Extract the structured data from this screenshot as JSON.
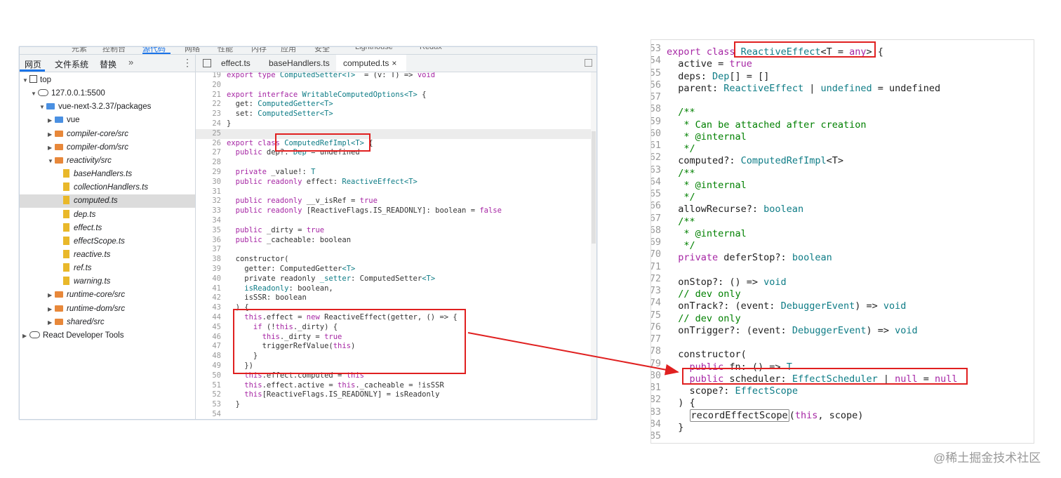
{
  "devtools": {
    "top_tabs_cut": [
      "元素",
      "控制台",
      "源代码",
      "网络",
      "性能",
      "内存",
      "应用",
      "安全",
      "Lighthouse",
      "Redux"
    ],
    "nav_tabs": [
      "网页",
      "文件系统",
      "替换"
    ],
    "nav_more": "»",
    "nav_kebab": "⋮",
    "tree": [
      {
        "label": "top",
        "depth": 0,
        "icon": "frame",
        "tri": "▼"
      },
      {
        "label": "127.0.0.1:5500",
        "depth": 1,
        "icon": "cloud",
        "tri": "▼"
      },
      {
        "label": "vue-next-3.2.37/packages",
        "depth": 2,
        "icon": "folder-blue",
        "tri": "▼"
      },
      {
        "label": "vue",
        "depth": 3,
        "icon": "folder-blue",
        "tri": "▶"
      },
      {
        "label": "compiler-core/src",
        "depth": 3,
        "icon": "folder-orange",
        "tri": "▶",
        "italic": true
      },
      {
        "label": "compiler-dom/src",
        "depth": 3,
        "icon": "folder-orange",
        "tri": "▶",
        "italic": true
      },
      {
        "label": "reactivity/src",
        "depth": 3,
        "icon": "folder-orange",
        "tri": "▼",
        "italic": true
      },
      {
        "label": "baseHandlers.ts",
        "depth": 4,
        "icon": "file",
        "tri": "",
        "italic": true
      },
      {
        "label": "collectionHandlers.ts",
        "depth": 4,
        "icon": "file",
        "tri": "",
        "italic": true
      },
      {
        "label": "computed.ts",
        "depth": 4,
        "icon": "file",
        "tri": "",
        "italic": true,
        "selected": true
      },
      {
        "label": "dep.ts",
        "depth": 4,
        "icon": "file",
        "tri": "",
        "italic": true
      },
      {
        "label": "effect.ts",
        "depth": 4,
        "icon": "file",
        "tri": "",
        "italic": true
      },
      {
        "label": "effectScope.ts",
        "depth": 4,
        "icon": "file",
        "tri": "",
        "italic": true
      },
      {
        "label": "reactive.ts",
        "depth": 4,
        "icon": "file",
        "tri": "",
        "italic": true
      },
      {
        "label": "ref.ts",
        "depth": 4,
        "icon": "file",
        "tri": "",
        "italic": true
      },
      {
        "label": "warning.ts",
        "depth": 4,
        "icon": "file",
        "tri": "",
        "italic": true
      },
      {
        "label": "runtime-core/src",
        "depth": 3,
        "icon": "folder-orange",
        "tri": "▶",
        "italic": true
      },
      {
        "label": "runtime-dom/src",
        "depth": 3,
        "icon": "folder-orange",
        "tri": "▶",
        "italic": true
      },
      {
        "label": "shared/src",
        "depth": 3,
        "icon": "folder-orange",
        "tri": "▶",
        "italic": true
      },
      {
        "label": "React Developer Tools",
        "depth": 0,
        "icon": "cloud",
        "tri": "▶"
      }
    ],
    "editor_tabs": [
      "effect.ts",
      "baseHandlers.ts",
      "computed.ts"
    ],
    "editor_close": "×",
    "code": [
      {
        "n": "19",
        "t": [
          [
            "kw",
            "export type "
          ],
          [
            "ty",
            "ComputedSetter<T>"
          ],
          [
            "",
            "  = (v: T) => "
          ],
          [
            "kw",
            "void"
          ]
        ]
      },
      {
        "n": "20",
        "t": []
      },
      {
        "n": "21",
        "t": [
          [
            "kw",
            "export interface "
          ],
          [
            "ty",
            "WritableComputedOptions<T>"
          ],
          [
            "",
            " {"
          ]
        ]
      },
      {
        "n": "22",
        "t": [
          [
            "",
            "  get: "
          ],
          [
            "ty",
            "ComputedGetter<T>"
          ]
        ]
      },
      {
        "n": "23",
        "t": [
          [
            "",
            "  set: "
          ],
          [
            "ty",
            "ComputedSetter<T>"
          ]
        ]
      },
      {
        "n": "24",
        "t": [
          [
            "",
            "}"
          ]
        ]
      },
      {
        "n": "25",
        "t": [],
        "hl": true
      },
      {
        "n": "26",
        "t": [
          [
            "kw",
            "export class "
          ],
          [
            "ty",
            "ComputedRefImpl<T>"
          ],
          [
            "",
            " {"
          ]
        ]
      },
      {
        "n": "27",
        "t": [
          [
            "kw",
            "  public "
          ],
          [
            "",
            "dep?: "
          ],
          [
            "ty",
            "Dep"
          ],
          [
            "",
            " = undefined"
          ]
        ]
      },
      {
        "n": "28",
        "t": []
      },
      {
        "n": "29",
        "t": [
          [
            "kw",
            "  private "
          ],
          [
            "",
            "_value!: "
          ],
          [
            "ty",
            "T"
          ]
        ]
      },
      {
        "n": "30",
        "t": [
          [
            "kw",
            "  public readonly "
          ],
          [
            "",
            "effect: "
          ],
          [
            "ty",
            "ReactiveEffect<T>"
          ]
        ]
      },
      {
        "n": "31",
        "t": []
      },
      {
        "n": "32",
        "t": [
          [
            "kw",
            "  public readonly "
          ],
          [
            "",
            "__v_isRef = "
          ],
          [
            "kw",
            "true"
          ]
        ]
      },
      {
        "n": "33",
        "t": [
          [
            "kw",
            "  public readonly "
          ],
          [
            "",
            "[ReactiveFlags.IS_READONLY]: boolean = "
          ],
          [
            "kw",
            "false"
          ]
        ]
      },
      {
        "n": "34",
        "t": []
      },
      {
        "n": "35",
        "t": [
          [
            "kw",
            "  public "
          ],
          [
            "",
            "_dirty = "
          ],
          [
            "kw",
            "true"
          ]
        ]
      },
      {
        "n": "36",
        "t": [
          [
            "kw",
            "  public "
          ],
          [
            "",
            "_cacheable: boolean"
          ]
        ]
      },
      {
        "n": "37",
        "t": []
      },
      {
        "n": "38",
        "t": [
          [
            "",
            "  constructor("
          ]
        ]
      },
      {
        "n": "39",
        "t": [
          [
            "",
            "    getter: ComputedGetter"
          ],
          [
            "ty",
            "<T>"
          ],
          [
            ","
          ]
        ]
      },
      {
        "n": "40",
        "t": [
          [
            "",
            "    private readonly "
          ],
          [
            "ty",
            "_setter"
          ],
          [
            "",
            ": ComputedSetter"
          ],
          [
            "ty",
            "<T>"
          ],
          [
            ","
          ]
        ]
      },
      {
        "n": "41",
        "t": [
          [
            "ty",
            "    isReadonly"
          ],
          [
            "",
            ": boolean,"
          ]
        ]
      },
      {
        "n": "42",
        "t": [
          [
            "",
            "    isSSR: boolean"
          ]
        ]
      },
      {
        "n": "43",
        "t": [
          [
            "",
            "  ) {"
          ]
        ]
      },
      {
        "n": "44",
        "t": [
          [
            "kw",
            "    this"
          ],
          [
            "",
            ".effect = "
          ],
          [
            "kw",
            "new "
          ],
          [
            "",
            "ReactiveEffect(getter, () => {"
          ]
        ]
      },
      {
        "n": "45",
        "t": [
          [
            "kw",
            "      if "
          ],
          [
            "",
            "(!"
          ],
          [
            "kw",
            "this"
          ],
          [
            "",
            "._dirty) {"
          ]
        ]
      },
      {
        "n": "46",
        "t": [
          [
            "kw",
            "        this"
          ],
          [
            "",
            "._dirty = "
          ],
          [
            "kw",
            "true"
          ]
        ]
      },
      {
        "n": "47",
        "t": [
          [
            "",
            "        triggerRefValue("
          ],
          [
            "kw",
            "this"
          ],
          [
            "",
            ")"
          ]
        ]
      },
      {
        "n": "48",
        "t": [
          [
            "",
            "      }"
          ]
        ]
      },
      {
        "n": "49",
        "t": [
          [
            "",
            "    })"
          ]
        ]
      },
      {
        "n": "50",
        "t": [
          [
            "kw",
            "    this"
          ],
          [
            "",
            ".effect.computed = "
          ],
          [
            "kw",
            "this"
          ]
        ]
      },
      {
        "n": "51",
        "t": [
          [
            "kw",
            "    this"
          ],
          [
            "",
            ".effect.active = "
          ],
          [
            "kw",
            "this"
          ],
          [
            "",
            "._cacheable = !isSSR"
          ]
        ]
      },
      {
        "n": "52",
        "t": [
          [
            "kw",
            "    this"
          ],
          [
            "",
            "[ReactiveFlags.IS_READONLY] = isReadonly"
          ]
        ]
      },
      {
        "n": "53",
        "t": [
          [
            "",
            "  }"
          ]
        ]
      },
      {
        "n": "54",
        "t": []
      }
    ]
  },
  "right_code": [
    {
      "n": "53",
      "t": [
        [
          "rk",
          "export class "
        ],
        [
          "rt",
          "ReactiveEffect"
        ],
        [
          "",
          "<T = "
        ],
        [
          "rk",
          "any"
        ],
        [
          "",
          "> {"
        ]
      ]
    },
    {
      "n": "54",
      "t": [
        [
          "",
          "  active = "
        ],
        [
          "rk",
          "true"
        ]
      ]
    },
    {
      "n": "55",
      "t": [
        [
          "",
          "  deps: "
        ],
        [
          "rt",
          "Dep"
        ],
        [
          "",
          "[] = []"
        ]
      ]
    },
    {
      "n": "56",
      "t": [
        [
          "",
          "  parent: "
        ],
        [
          "rt",
          "ReactiveEffect"
        ],
        [
          "",
          " | "
        ],
        [
          "rt",
          "undefined"
        ],
        [
          "",
          " = undefined"
        ]
      ]
    },
    {
      "n": "57",
      "t": []
    },
    {
      "n": "58",
      "t": [
        [
          "rc",
          "  /**"
        ]
      ]
    },
    {
      "n": "59",
      "t": [
        [
          "rc",
          "   * Can be attached after creation"
        ]
      ]
    },
    {
      "n": "60",
      "t": [
        [
          "rc",
          "   * @internal"
        ]
      ]
    },
    {
      "n": "61",
      "t": [
        [
          "rc",
          "   */"
        ]
      ]
    },
    {
      "n": "62",
      "t": [
        [
          "",
          "  computed?: "
        ],
        [
          "rt",
          "ComputedRefImpl"
        ],
        [
          "",
          "<T>"
        ]
      ]
    },
    {
      "n": "63",
      "t": [
        [
          "rc",
          "  /**"
        ]
      ]
    },
    {
      "n": "64",
      "t": [
        [
          "rc",
          "   * @internal"
        ]
      ]
    },
    {
      "n": "65",
      "t": [
        [
          "rc",
          "   */"
        ]
      ]
    },
    {
      "n": "66",
      "t": [
        [
          "",
          "  allowRecurse?: "
        ],
        [
          "rt",
          "boolean"
        ]
      ]
    },
    {
      "n": "67",
      "t": [
        [
          "rc",
          "  /**"
        ]
      ]
    },
    {
      "n": "68",
      "t": [
        [
          "rc",
          "   * @internal"
        ]
      ]
    },
    {
      "n": "69",
      "t": [
        [
          "rc",
          "   */"
        ]
      ]
    },
    {
      "n": "70",
      "t": [
        [
          "rk",
          "  private "
        ],
        [
          "",
          "deferStop?: "
        ],
        [
          "rt",
          "boolean"
        ]
      ]
    },
    {
      "n": "71",
      "t": []
    },
    {
      "n": "72",
      "t": [
        [
          "",
          "  onStop?: () => "
        ],
        [
          "rt",
          "void"
        ]
      ]
    },
    {
      "n": "73",
      "t": [
        [
          "rc",
          "  // dev only"
        ]
      ]
    },
    {
      "n": "74",
      "t": [
        [
          "",
          "  onTrack?: (event: "
        ],
        [
          "rt",
          "DebuggerEvent"
        ],
        [
          "",
          ") => "
        ],
        [
          "rt",
          "void"
        ]
      ]
    },
    {
      "n": "75",
      "t": [
        [
          "rc",
          "  // dev only"
        ]
      ]
    },
    {
      "n": "76",
      "t": [
        [
          "",
          "  onTrigger?: (event: "
        ],
        [
          "rt",
          "DebuggerEvent"
        ],
        [
          "",
          ") => "
        ],
        [
          "rt",
          "void"
        ]
      ]
    },
    {
      "n": "77",
      "t": []
    },
    {
      "n": "78",
      "t": [
        [
          "",
          "  constructor("
        ]
      ]
    },
    {
      "n": "79",
      "t": [
        [
          "rk",
          "    public "
        ],
        [
          "",
          "fn: () => "
        ],
        [
          "rt",
          "T"
        ],
        [
          ","
        ]
      ]
    },
    {
      "n": "80",
      "t": [
        [
          "rk",
          "    public "
        ],
        [
          "",
          "scheduler: "
        ],
        [
          "rt",
          "EffectScheduler"
        ],
        [
          "",
          " | "
        ],
        [
          "rk",
          "null"
        ],
        [
          "",
          " = "
        ],
        [
          "rk",
          "null"
        ],
        [
          ","
        ]
      ]
    },
    {
      "n": "81",
      "t": [
        [
          "",
          "    scope?: "
        ],
        [
          "rt",
          "EffectScope"
        ]
      ]
    },
    {
      "n": "82",
      "t": [
        [
          "",
          "  ) {"
        ]
      ]
    },
    {
      "n": "83",
      "t": [
        [
          "",
          "    "
        ],
        [
          "box",
          "recordEffectScope"
        ],
        [
          "",
          "("
        ],
        [
          "rk",
          "this"
        ],
        [
          "",
          ", scope)"
        ]
      ]
    },
    {
      "n": "84",
      "t": [
        [
          "",
          "  }"
        ]
      ]
    },
    {
      "n": "85",
      "t": []
    }
  ],
  "watermark": "@稀土掘金技术社区",
  "colors": {
    "highlight_red": "#e02020",
    "accent_blue": "#1a73e8"
  }
}
